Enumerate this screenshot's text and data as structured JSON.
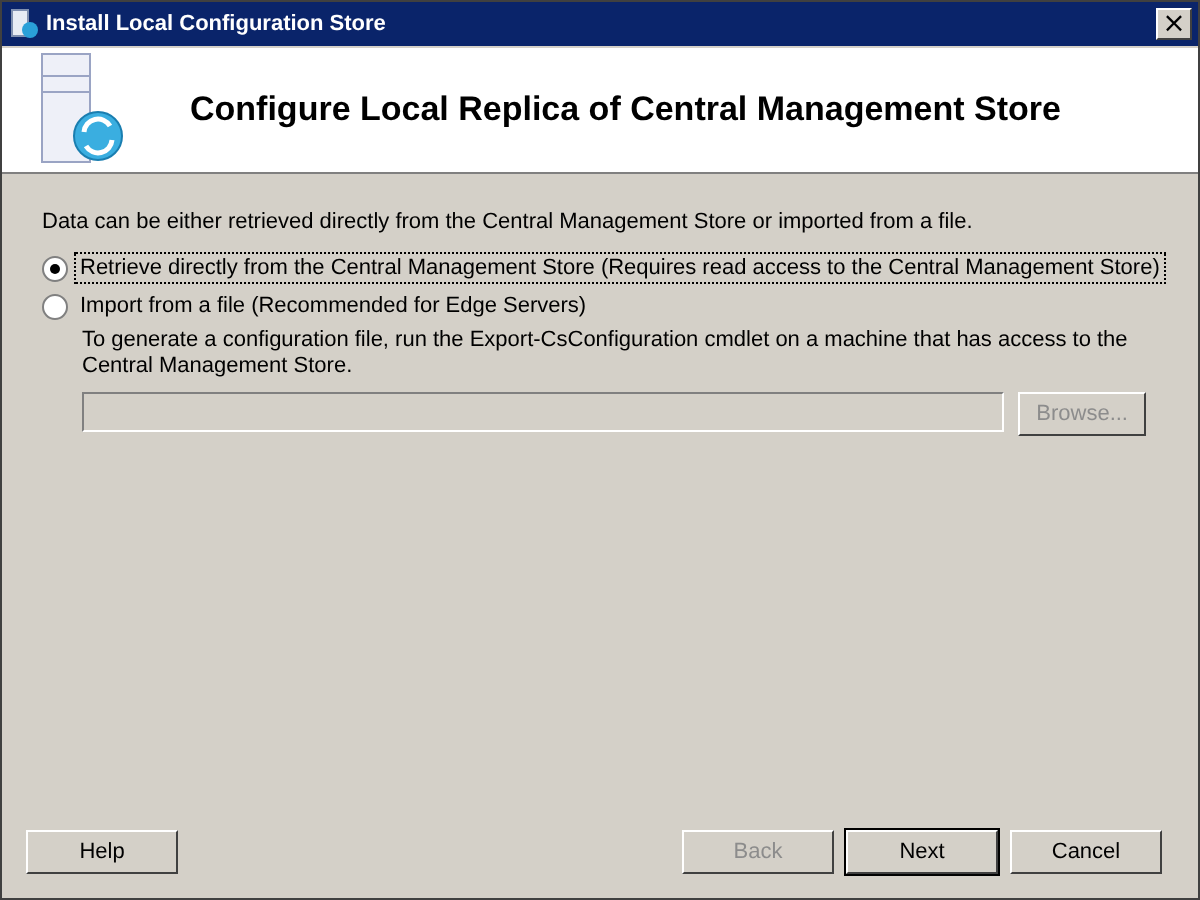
{
  "window": {
    "title": "Install Local Configuration Store",
    "close_label": "×"
  },
  "header": {
    "title": "Configure Local Replica of Central Management Store"
  },
  "intro": "Data can be either retrieved directly from the Central Management Store or imported from a file.",
  "options": [
    {
      "label": "Retrieve directly from the Central Management Store (Requires read access to the Central Management Store)",
      "selected": true,
      "focused": true
    },
    {
      "label": "Import from a file (Recommended for Edge Servers)",
      "selected": false,
      "focused": false
    }
  ],
  "import_hint": "To generate a configuration file, run the Export-CsConfiguration cmdlet on a machine that has access to the Central Management Store.",
  "file_field": {
    "disabled": true
  },
  "browse_button": {
    "label": "Browse...",
    "disabled": true
  },
  "buttons": [
    {
      "label": "Help",
      "disabled": false,
      "default": false
    },
    {
      "label": "Back",
      "disabled": true,
      "default": false
    },
    {
      "label": "Next",
      "disabled": false,
      "default": true
    },
    {
      "label": "Cancel",
      "disabled": false,
      "default": false
    }
  ]
}
